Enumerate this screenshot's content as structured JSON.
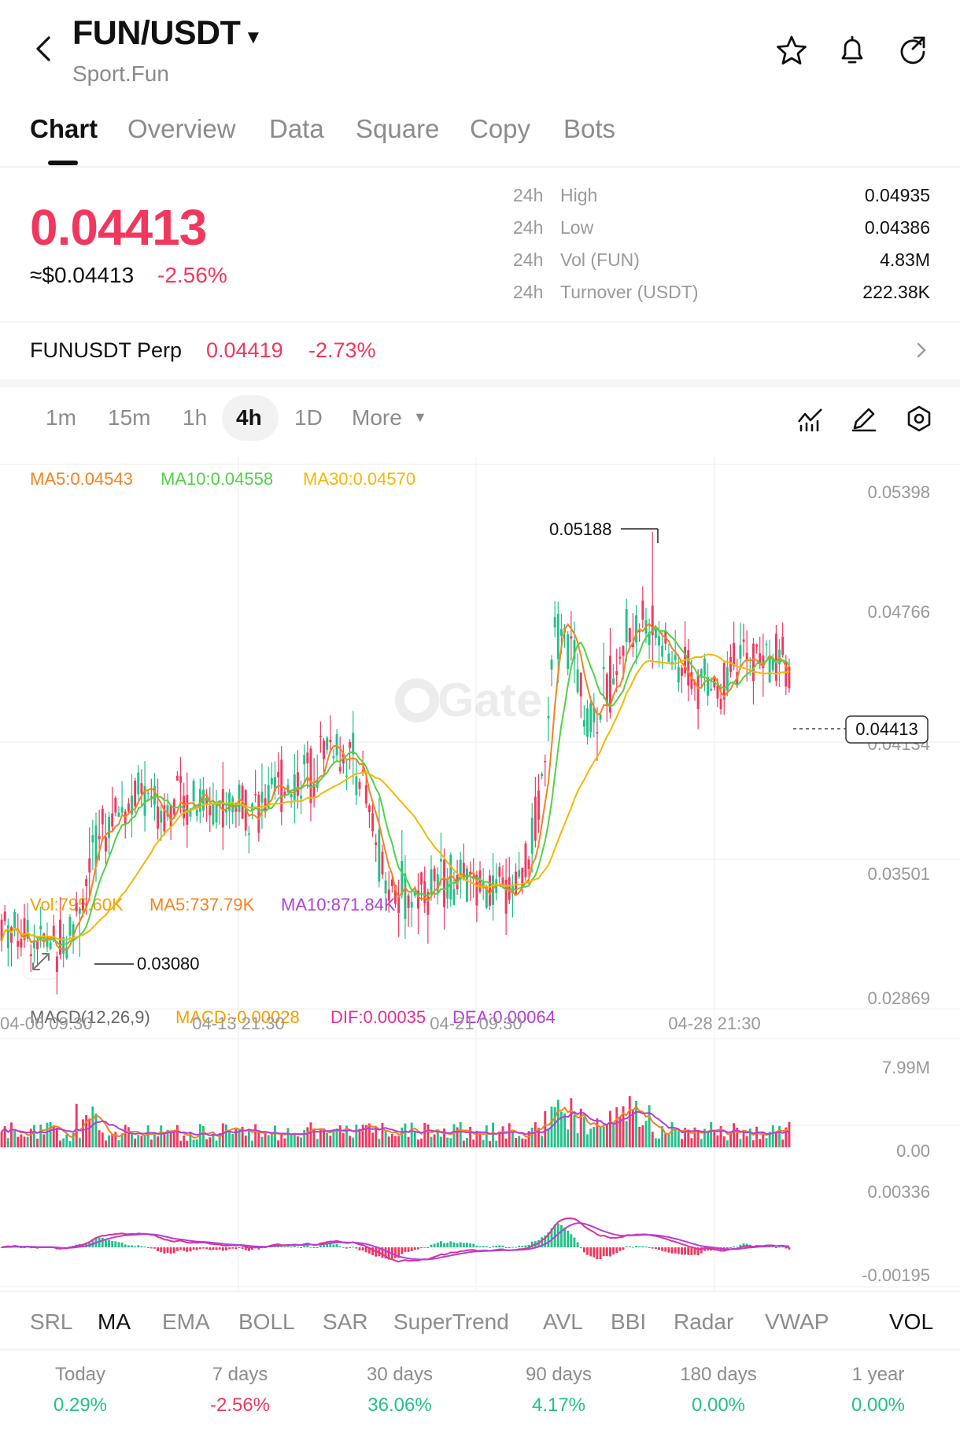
{
  "header": {
    "pair": "FUN/USDT",
    "subtitle": "Sport.Fun"
  },
  "tabs": [
    "Chart",
    "Overview",
    "Data",
    "Square",
    "Copy",
    "Bots"
  ],
  "price": {
    "last": "0.04413",
    "usd": "≈$0.04413",
    "change": "-2.56%"
  },
  "stats": [
    {
      "period": "24h",
      "label": "High",
      "value": "0.04935"
    },
    {
      "period": "24h",
      "label": "Low",
      "value": "0.04386"
    },
    {
      "period": "24h",
      "label": "Vol (FUN)",
      "value": "4.83M"
    },
    {
      "period": "24h",
      "label": "Turnover (USDT)",
      "value": "222.38K"
    }
  ],
  "perp": {
    "name": "FUNUSDT Perp",
    "price": "0.04419",
    "change": "-2.73%"
  },
  "intervals": [
    "1m",
    "15m",
    "1h",
    "4h",
    "1D",
    "More"
  ],
  "ma_legend": [
    "MA5:0.04543",
    "MA10:0.04558",
    "MA30:0.04570"
  ],
  "vol_legend": [
    "Vol:795.60K",
    "MA5:737.79K",
    "MA10:871.84K"
  ],
  "macd_legend": [
    "MACD(12,26,9)",
    "MACD:-0.00028",
    "DIF:0.00035",
    "DEA:0.00064"
  ],
  "indicators": [
    "SRL",
    "MA",
    "EMA",
    "BOLL",
    "SAR",
    "SuperTrend",
    "AVL",
    "BBI",
    "Radar",
    "VWAP",
    "VOL"
  ],
  "performance": [
    {
      "label": "Today",
      "value": "0.29%"
    },
    {
      "label": "7 days",
      "value": "-2.56%"
    },
    {
      "label": "30 days",
      "value": "36.06%"
    },
    {
      "label": "90 days",
      "value": "4.17%"
    },
    {
      "label": "180 days",
      "value": "0.00%"
    },
    {
      "label": "1 year",
      "value": "0.00%"
    }
  ],
  "colors": {
    "up": "#22c08a",
    "down": "#f0385f",
    "ma5": "#f5821f",
    "ma10": "#52d147",
    "ma30": "#f5b800",
    "dif": "#e0309a",
    "dea": "#b040d8",
    "text_muted": "#8c8c8c"
  },
  "watermark": "Gate",
  "chart_data": {
    "type": "candlestick",
    "y_ticks": [
      "0.05398",
      "0.04766",
      "0.04134",
      "0.03501",
      "0.02869"
    ],
    "ylim": [
      0.02869,
      0.05398
    ],
    "x_ticks": [
      "04-06 09:30",
      "04-13 21:30",
      "04-21 09:30",
      "04-28 21:30"
    ],
    "annotations": {
      "high": "0.05188",
      "low": "0.03080",
      "current": "0.04413"
    },
    "close_path": [
      [
        0,
        0.0325
      ],
      [
        5,
        0.0322
      ],
      [
        10,
        0.0318
      ],
      [
        15,
        0.0314
      ],
      [
        20,
        0.0318
      ],
      [
        25,
        0.034
      ],
      [
        30,
        0.0368
      ],
      [
        35,
        0.0378
      ],
      [
        40,
        0.0385
      ],
      [
        45,
        0.0388
      ],
      [
        50,
        0.0382
      ],
      [
        55,
        0.0386
      ],
      [
        60,
        0.0384
      ],
      [
        65,
        0.0385
      ],
      [
        70,
        0.0383
      ],
      [
        75,
        0.0386
      ],
      [
        80,
        0.0382
      ],
      [
        85,
        0.039
      ],
      [
        90,
        0.0396
      ],
      [
        95,
        0.0398
      ],
      [
        100,
        0.0415
      ],
      [
        105,
        0.041
      ],
      [
        110,
        0.04
      ],
      [
        115,
        0.0365
      ],
      [
        120,
        0.0342
      ],
      [
        125,
        0.0338
      ],
      [
        130,
        0.0342
      ],
      [
        135,
        0.0344
      ],
      [
        140,
        0.0346
      ],
      [
        145,
        0.0342
      ],
      [
        150,
        0.034
      ],
      [
        155,
        0.034
      ],
      [
        160,
        0.0346
      ],
      [
        165,
        0.038
      ],
      [
        170,
        0.0472
      ],
      [
        175,
        0.0462
      ],
      [
        180,
        0.0424
      ],
      [
        185,
        0.0436
      ],
      [
        190,
        0.046
      ],
      [
        195,
        0.048
      ],
      [
        200,
        0.0472
      ],
      [
        205,
        0.0458
      ],
      [
        210,
        0.045
      ],
      [
        215,
        0.0446
      ],
      [
        220,
        0.044
      ],
      [
        225,
        0.0452
      ],
      [
        230,
        0.0455
      ],
      [
        235,
        0.0456
      ],
      [
        240,
        0.0458
      ],
      [
        242,
        0.0441
      ]
    ],
    "volume_ylim": [
      "0.00",
      "7.99M"
    ],
    "macd_ylim": [
      "0.00336",
      "-0.00195"
    ]
  }
}
